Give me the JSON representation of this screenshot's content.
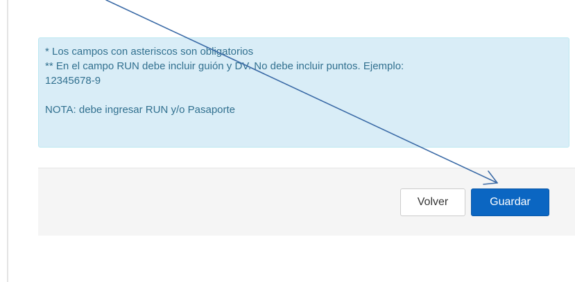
{
  "info": {
    "line1": "* Los campos con asteriscos son obligatorios",
    "line2": "** En el campo RUN debe incluir guión y DV. No debe incluir puntos. Ejemplo:",
    "line3": "12345678-9",
    "line4": "NOTA: debe ingresar RUN y/o Pasaporte"
  },
  "footer": {
    "back_label": "Volver",
    "save_label": "Guardar"
  },
  "colors": {
    "info_background": "#d9edf7",
    "info_text": "#31708f",
    "primary_button": "#0b66c2",
    "annotation_arrow": "#3a6aa6"
  },
  "annotation": {
    "icon": "arrow-annotation-icon"
  }
}
